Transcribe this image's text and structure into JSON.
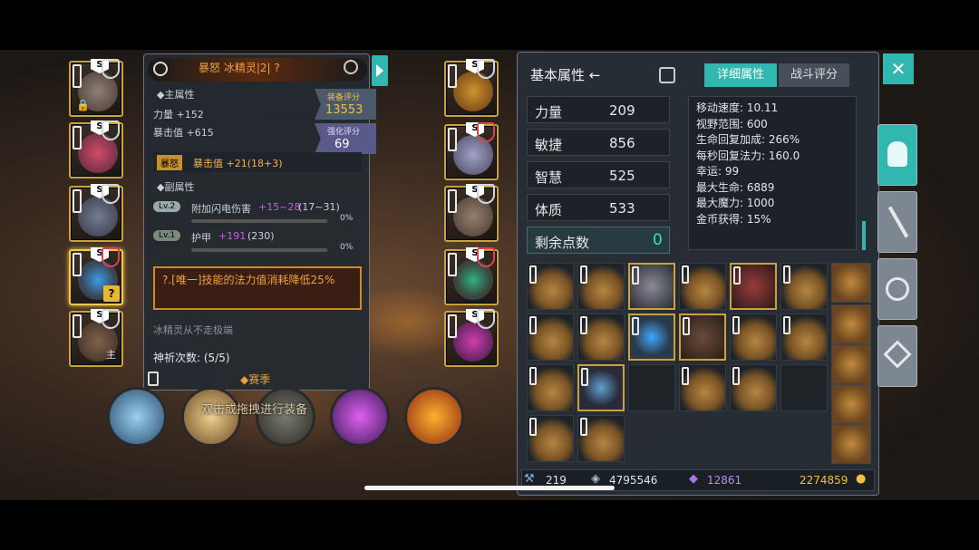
{
  "item_panel": {
    "title": "暴怒 冰精灵|2| ?",
    "section_main": "◆主属性",
    "main_attrs": [
      "力量 +152",
      "暴击值 +615"
    ],
    "equip_score_label": "装备评分",
    "equip_score_value": "13553",
    "enhance_score_label": "强化评分",
    "enhance_score_value": "69",
    "rage_tag": "暴怒",
    "rage_attr": "暴击值 +21(18+3)",
    "section_sub": "◆副属性",
    "sub_attrs": [
      {
        "level": "Lv.2",
        "name": "附加闪电伤害",
        "value": "+15~28",
        "base": "(17~31)",
        "pct": "0%"
      },
      {
        "level": "Lv.1",
        "name": "护甲",
        "value": "+191",
        "base": "(230)",
        "pct": "0%"
      }
    ],
    "unique_text": "?.[唯一]技能的法力值消耗降低25%",
    "flavor": "冰精灵从不走极端",
    "pray_count": "神祈次数: (5/5)",
    "season": "◆赛季"
  },
  "drag_hint": "双击或拖拽进行装备",
  "stat_panel": {
    "title": "基本属性 ←",
    "tab_detail": "详细属性",
    "tab_battle": "战斗评分",
    "stats": [
      {
        "name": "力量",
        "value": "209"
      },
      {
        "name": "敏捷",
        "value": "856"
      },
      {
        "name": "智慧",
        "value": "525"
      },
      {
        "name": "体质",
        "value": "533"
      }
    ],
    "remaining_label": "剩余点数",
    "remaining_value": "0",
    "detail_lines": [
      "移动速度: 10.11",
      "视野范围: 600",
      "生命回复加成: 266%",
      "每秒回复法力: 160.0",
      "幸运: 99",
      "最大生命: 6889",
      "最大魔力: 1000",
      "金币获得: 15%"
    ]
  },
  "currency": {
    "a": "219",
    "b": "4795546",
    "c": "12861",
    "d": "2274859"
  },
  "close_label": "✕",
  "colors": {
    "accent": "#2fb7b0",
    "gold": "#c9a23a",
    "score": "#f0c040"
  }
}
